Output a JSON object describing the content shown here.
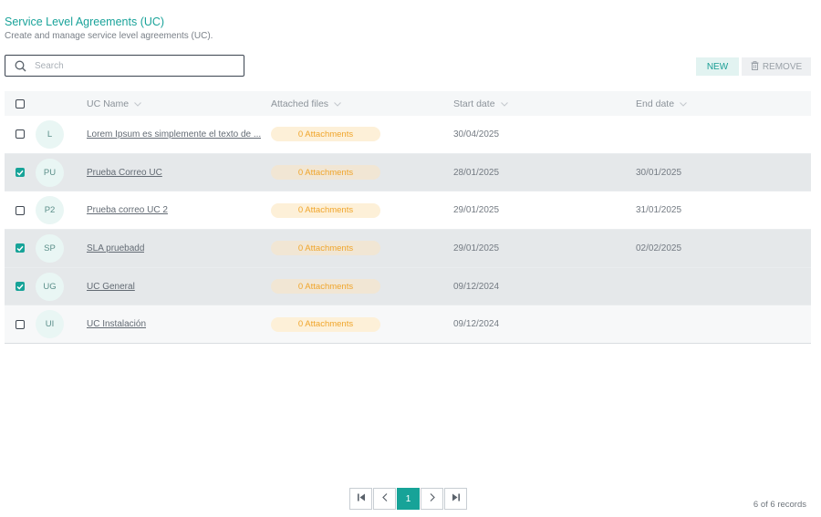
{
  "header": {
    "title": "Service Level Agreements (UC)",
    "subtitle": "Create and manage service level agreements (UC)."
  },
  "search": {
    "placeholder": "Search",
    "value": ""
  },
  "toolbar": {
    "new_label": "NEW",
    "remove_label": "REMOVE"
  },
  "table": {
    "columns": [
      "UC Name",
      "Attached files",
      "Start date",
      "End date"
    ],
    "rows": [
      {
        "initials": "L",
        "name": "Lorem Ipsum es simplemente el texto de ...",
        "attachments": "0 Attachments",
        "start": "30/04/2025",
        "end": "",
        "checked": false
      },
      {
        "initials": "PU",
        "name": "Prueba Correo UC",
        "attachments": "0 Attachments",
        "start": "28/01/2025",
        "end": "30/01/2025",
        "checked": true
      },
      {
        "initials": "P2",
        "name": "Prueba correo UC 2",
        "attachments": "0 Attachments",
        "start": "29/01/2025",
        "end": "31/01/2025",
        "checked": false
      },
      {
        "initials": "SP",
        "name": "SLA pruebadd",
        "attachments": "0 Attachments",
        "start": "29/01/2025",
        "end": "02/02/2025",
        "checked": true
      },
      {
        "initials": "UG",
        "name": "UC General",
        "attachments": "0 Attachments",
        "start": "09/12/2024",
        "end": "",
        "checked": true
      },
      {
        "initials": "UI",
        "name": "UC Instalación",
        "attachments": "0 Attachments",
        "start": "09/12/2024",
        "end": "",
        "checked": false
      }
    ]
  },
  "pagination": {
    "current_page": "1",
    "records": "6 of 6 records"
  },
  "colors": {
    "accent": "#17a398",
    "badge_text": "#f0a52b",
    "badge_bg": "#fdf0d8"
  },
  "icons": [
    "search-icon",
    "trash-icon",
    "chevron-down-icon",
    "first-page-icon",
    "prev-page-icon",
    "next-page-icon",
    "last-page-icon",
    "checkmark-icon"
  ]
}
